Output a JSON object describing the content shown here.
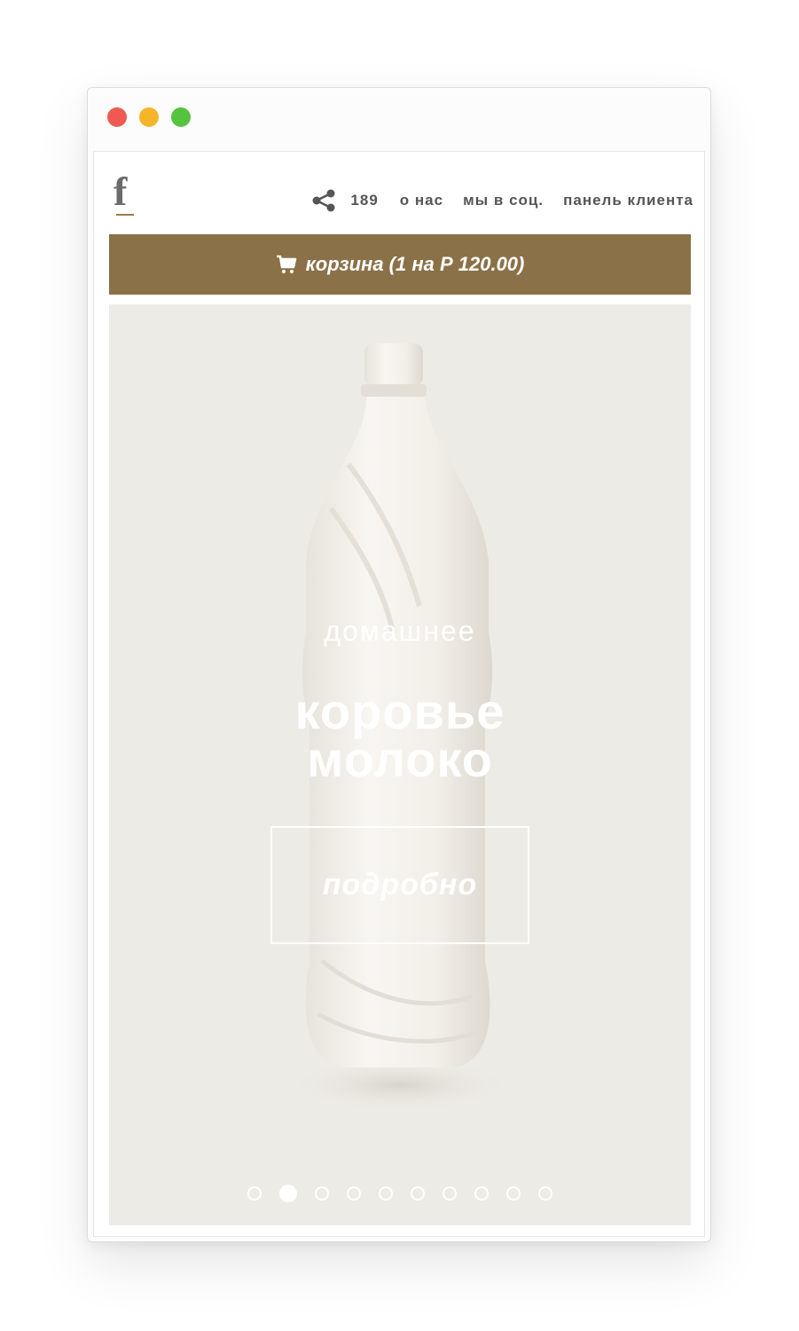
{
  "window": {
    "controls": [
      "close",
      "minimize",
      "maximize"
    ],
    "control_colors": {
      "close": "#ee5a52",
      "minimize": "#f5b52b",
      "maximize": "#56c33f"
    }
  },
  "header": {
    "logo_letter": "f",
    "share_icon": "share-icon",
    "share_count": "189",
    "nav": [
      {
        "label": "о нас"
      },
      {
        "label": "мы в соц."
      },
      {
        "label": "панель клиента"
      }
    ]
  },
  "cart": {
    "icon": "cart-icon",
    "label": "корзина (1 на Р 120.00)",
    "background": "#8b7147"
  },
  "hero": {
    "background": "#edebe6",
    "subtitle": "домашнее",
    "title_line1": "коровье",
    "title_line2": "молоко",
    "button_label": "подробно",
    "slide_count": 10,
    "active_slide": 2
  }
}
